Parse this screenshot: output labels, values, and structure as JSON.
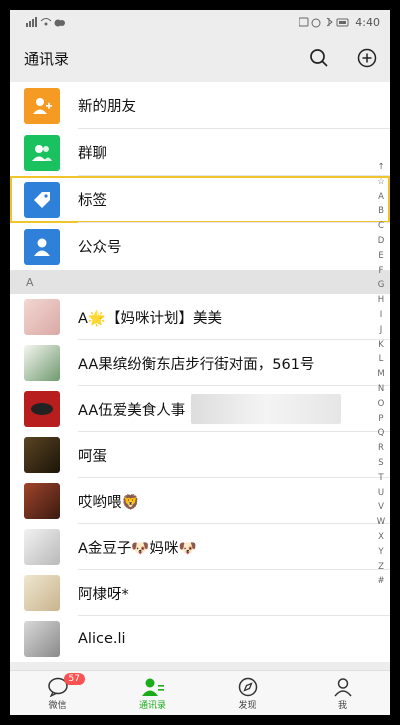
{
  "status": {
    "time": "4:40",
    "left_icons": "signal-wifi-cloud",
    "right_icons": "battery-alarm-bluetooth"
  },
  "header": {
    "title": "通讯录",
    "search_icon": "search-icon",
    "add_icon": "plus-circle-icon"
  },
  "features": [
    {
      "label": "新的朋友",
      "color": "#f59a23",
      "icon": "new-friend-icon"
    },
    {
      "label": "群聊",
      "color": "#19c15f",
      "icon": "group-chat-icon"
    },
    {
      "label": "标签",
      "color": "#2f80d9",
      "icon": "tag-icon"
    },
    {
      "label": "公众号",
      "color": "#2f80d9",
      "icon": "official-account-icon"
    }
  ],
  "section_label": "A",
  "contacts": [
    {
      "name": "A🌟【妈咪计划】美美"
    },
    {
      "name": "AA果缤纷衡东店步行街对面，561号"
    },
    {
      "name": "AA伍爱美食人事"
    },
    {
      "name": "呵蛋"
    },
    {
      "name": "哎哟喂🦁"
    },
    {
      "name": "A金豆子🐶妈咪🐶"
    },
    {
      "name": "阿棣呀*"
    },
    {
      "name": "Alice.li"
    }
  ],
  "index_letters": [
    "↑",
    "☆",
    "A",
    "B",
    "C",
    "D",
    "E",
    "F",
    "G",
    "H",
    "I",
    "J",
    "K",
    "L",
    "M",
    "N",
    "O",
    "P",
    "Q",
    "R",
    "S",
    "T",
    "U",
    "V",
    "W",
    "X",
    "Y",
    "Z",
    "#"
  ],
  "tabs": [
    {
      "label": "微信",
      "badge": "57",
      "icon": "chat-bubble-icon"
    },
    {
      "label": "通讯录",
      "icon": "contacts-icon"
    },
    {
      "label": "发现",
      "icon": "compass-icon"
    },
    {
      "label": "我",
      "icon": "profile-icon"
    }
  ],
  "colors": {
    "accent": "#1aad19",
    "selection": "#f0c52b",
    "badge": "#fa5151"
  }
}
